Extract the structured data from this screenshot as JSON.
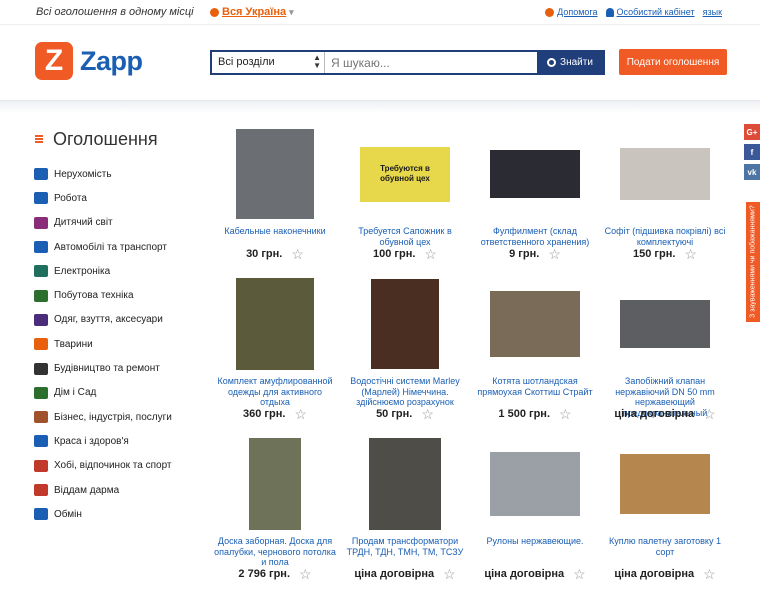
{
  "topbar": {
    "tagline": "Всі оголошення в одному місці",
    "region": "Вся Україна",
    "links": {
      "help": "Допомога",
      "cabinet": "Особистий кабінет",
      "lang": "язык"
    }
  },
  "header": {
    "logo_letter": "Z",
    "logo_text": "Zapp",
    "search": {
      "section": "Всі розділи",
      "placeholder": "Я шукаю...",
      "button": "Знайти"
    },
    "post_button": "Подати оголошення"
  },
  "sidebar": {
    "title": "Оголошення",
    "categories": [
      {
        "label": "Нерухомість",
        "icon": "house-icon",
        "color": "#1a5fb4"
      },
      {
        "label": "Робота",
        "icon": "briefcase-icon",
        "color": "#1a5fb4"
      },
      {
        "label": "Дитячий світ",
        "icon": "stroller-icon",
        "color": "#8a2c7a"
      },
      {
        "label": "Автомобілі та транспорт",
        "icon": "car-icon",
        "color": "#1a5fb4"
      },
      {
        "label": "Електроніка",
        "icon": "tv-icon",
        "color": "#1f6e5e"
      },
      {
        "label": "Побутова техніка",
        "icon": "washer-icon",
        "color": "#2c6e2c"
      },
      {
        "label": "Одяг, взуття, аксесуари",
        "icon": "jacket-icon",
        "color": "#4a2c7a"
      },
      {
        "label": "Тварини",
        "icon": "paw-icon",
        "color": "#e8600c"
      },
      {
        "label": "Будівництво та ремонт",
        "icon": "roller-icon",
        "color": "#333"
      },
      {
        "label": "Дім і Сад",
        "icon": "sofa-icon",
        "color": "#2c6e2c"
      },
      {
        "label": "Бізнес, індустрія, послуги",
        "icon": "wrench-icon",
        "color": "#a0522d"
      },
      {
        "label": "Краса і здоров'я",
        "icon": "lipstick-icon",
        "color": "#1a5fb4"
      },
      {
        "label": "Хобі, відпочинок та спорт",
        "icon": "bike-icon",
        "color": "#c0392b"
      },
      {
        "label": "Віддам дарма",
        "icon": "gift-icon",
        "color": "#c0392b"
      },
      {
        "label": "Обмін",
        "icon": "exchange-icon",
        "color": "#1a5fb4"
      }
    ]
  },
  "listings": [
    {
      "title": "Кабельные наконечники",
      "price": "30 грн.",
      "color": "#6b6e73"
    },
    {
      "title": "Требуется Сапожник в обувной цех",
      "price": "100 грн.",
      "color": "#e6d84a",
      "img_text": "Требуются в обувной цех"
    },
    {
      "title": "Фулфилмент (склад ответственного хранения)",
      "price": "9 грн.",
      "color": "#2b2b33"
    },
    {
      "title": "Софіт (підшивка покрівлі) всі комплектуючі",
      "price": "150 грн.",
      "color": "#c9c4bd"
    },
    {
      "title": "Комплект амуфлированной одежды для активного отдыха",
      "price": "360 грн.",
      "color": "#5b5a3a"
    },
    {
      "title": "Водостічні системи Marley (Марлей) Німеччина. здійснюємо розрахунок",
      "price": "50 грн.",
      "color": "#4a2e22"
    },
    {
      "title": "Котята шотландская прямоухая Скоттиш Страйт",
      "price": "1 500 грн.",
      "color": "#7a6a58"
    },
    {
      "title": "Запобіжний клапан нержавіючий DN 50 mm нержавеющий предохранительный",
      "price": "ціна договірна",
      "color": "#5c5e62"
    },
    {
      "title": "Доска заборная. Доска для опалубки, чернового потолка и пола",
      "price": "2 796 грн.",
      "color": "#6e7258"
    },
    {
      "title": "Продам трансформатори ТРДН, ТДН, ТМН, ТМ, ТСЗУ",
      "price": "ціна договірна",
      "color": "#4f4d48"
    },
    {
      "title": "Рулоны нержавеющие.",
      "price": "ціна договірна",
      "color": "#9aa0a6"
    },
    {
      "title": "Куплю палетну заготовку 1 сорт",
      "price": "ціна договірна",
      "color": "#b5874f"
    }
  ],
  "social": [
    {
      "label": "G+",
      "icon": "googleplus-icon",
      "color": "#dd4b39"
    },
    {
      "label": "f",
      "icon": "facebook-icon",
      "color": "#3b5998"
    },
    {
      "label": "vk",
      "icon": "vk-icon",
      "color": "#4c75a3"
    }
  ],
  "feedback": "З зауваженнями чи побажаннями?"
}
